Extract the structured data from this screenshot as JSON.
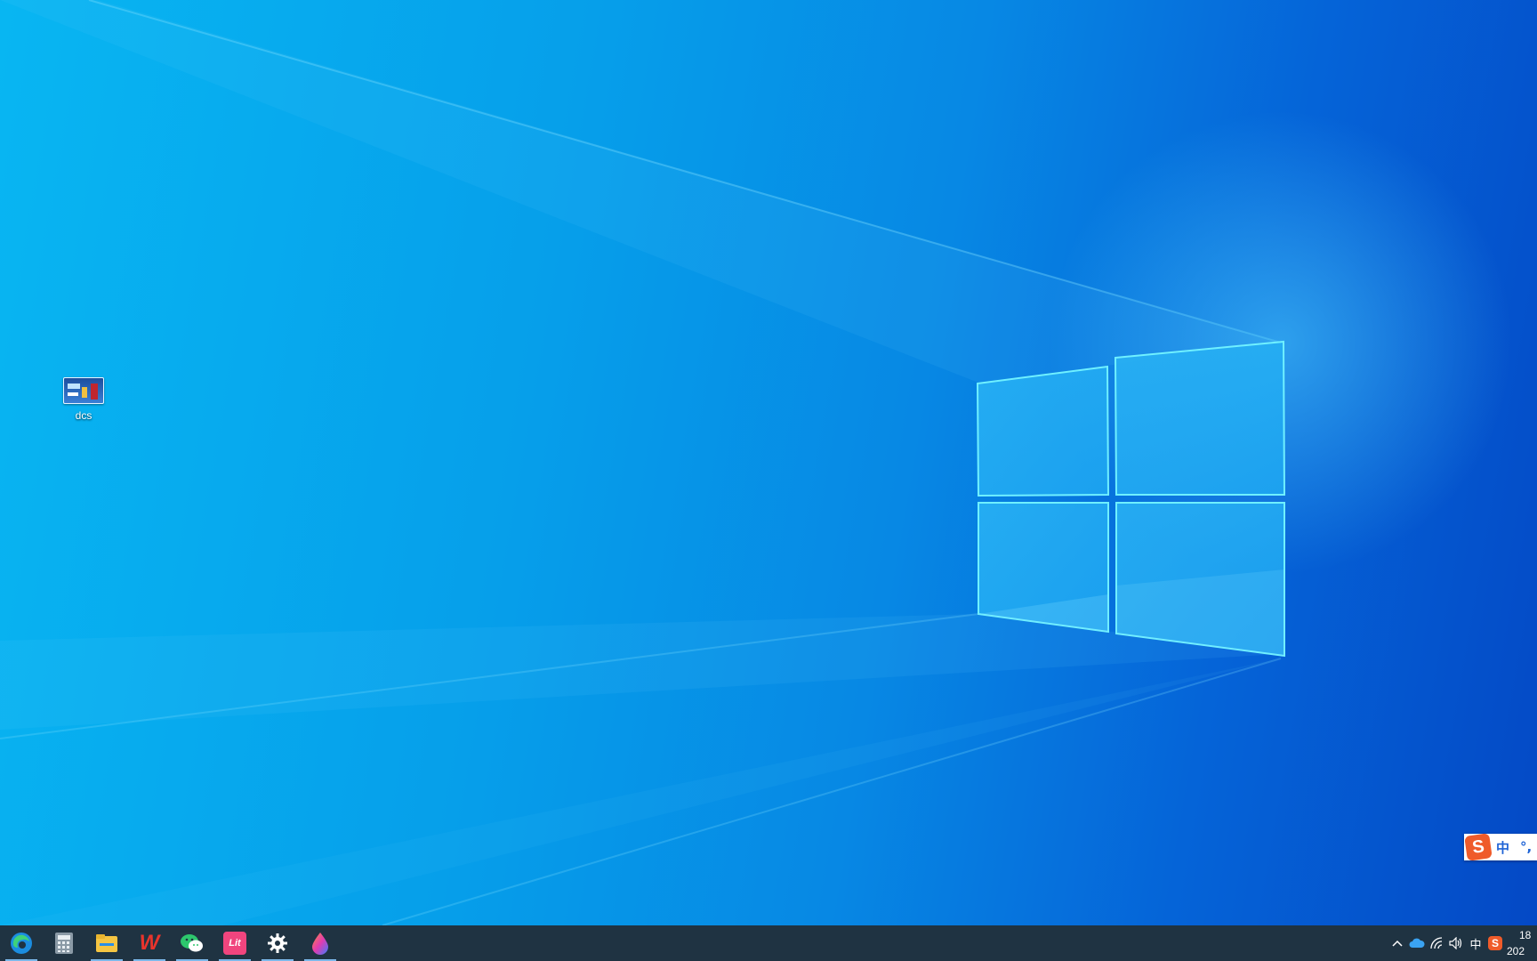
{
  "desktop": {
    "icons": [
      {
        "label": "dcs"
      }
    ]
  },
  "ime_floating_bar": {
    "logo": "S",
    "mode": "中",
    "punctuation": "°,"
  },
  "taskbar": {
    "apps": [
      {
        "name": "edge-icon",
        "running": true
      },
      {
        "name": "calculator-icon",
        "running": false
      },
      {
        "name": "file-explorer-icon",
        "running": true
      },
      {
        "name": "wps-office-icon",
        "label": "W",
        "running": true
      },
      {
        "name": "wechat-icon",
        "running": true
      },
      {
        "name": "app-pink-icon",
        "label": "Lit",
        "running": true
      },
      {
        "name": "settings-icon",
        "running": true
      },
      {
        "name": "paint-drop-icon",
        "running": true
      }
    ],
    "tray": {
      "ime_indicator": "中",
      "ime_logo": "S",
      "time": "18",
      "date": "202"
    }
  },
  "colors": {
    "taskbar": "#1f3342",
    "running_indicator": "#7cb8ea",
    "wallpaper_left": "#08b6f2",
    "wallpaper_right": "#0448c5",
    "ime_logo": "#ef5b2a"
  }
}
